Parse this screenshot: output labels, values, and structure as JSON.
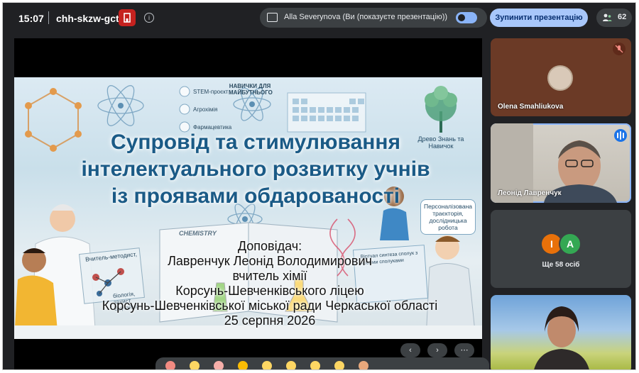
{
  "topbar": {
    "time": "15:07",
    "meeting_code": "chh-skzw-gct",
    "presenting_text": "Alla Severynova (Ви (показуєте презентацію))",
    "stop_button": "Зупинити презентацію",
    "participant_count": "62"
  },
  "slide": {
    "title_lines": [
      "Супровід та стимулювання",
      "інтелектуального розвитку учнів",
      "із проявами обдарованості"
    ],
    "speaker_lines": [
      "Доповідач:",
      "Лавренчук Леонід Володимирович",
      "вчитель хімії",
      "Корсунь-Шевченківського ліцею",
      "Корсунь-Шевченківської міської ради Черкаської області",
      "25 серпня 2026"
    ],
    "labels": {
      "skills": "НАВИЧКИ ДЛЯ МАЙБУТНЬОГО",
      "stem": "STEM-проєкт",
      "agro": "Агрохімія",
      "pharma": "Фармацевтика",
      "tree_caption": "Древо Знань та Навичок",
      "chemistry": "CHEMISTRY",
      "mentor": "Вчитель-методист,",
      "bio": "біологія, захист Відчаймо",
      "virtual": "Віртуал синтеза сполук з новими сполуками",
      "bubble": "Персоналізована траєкторія, дослідницька робота"
    }
  },
  "participants": [
    {
      "name": "Olena Smahliukova"
    },
    {
      "name": "Леонід Лавренчук"
    },
    {
      "more_label": "Ще 58 осіб",
      "avatars": [
        {
          "letter": "I",
          "color": "#e8710a"
        },
        {
          "letter": "A",
          "color": "#34a853"
        }
      ]
    },
    {
      "name": ""
    }
  ],
  "colors": {
    "accent": "#a8c7fa",
    "background": "#202124",
    "title": "#1a5a86"
  }
}
